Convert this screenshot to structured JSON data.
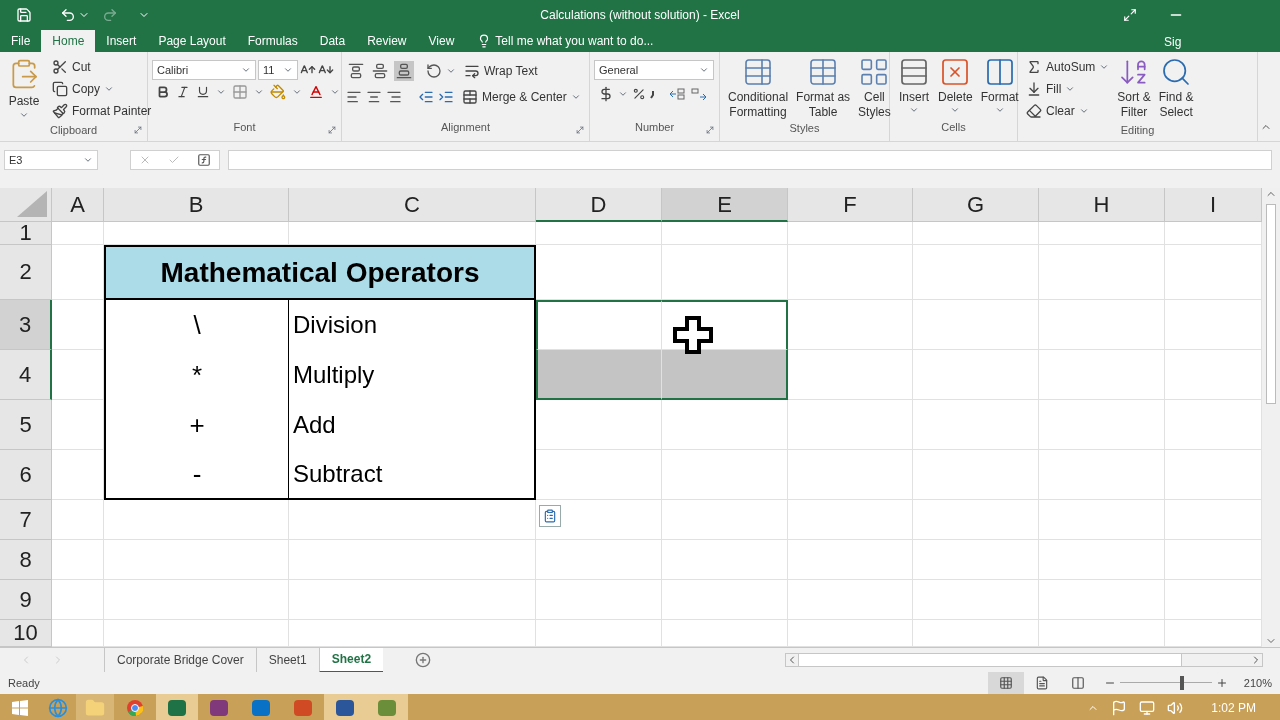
{
  "title_bar": {
    "title": "Calculations (without solution) - Excel"
  },
  "tabs": [
    {
      "label": "File",
      "selected": false
    },
    {
      "label": "Home",
      "selected": true
    },
    {
      "label": "Insert",
      "selected": false
    },
    {
      "label": "Page Layout",
      "selected": false
    },
    {
      "label": "Formulas",
      "selected": false
    },
    {
      "label": "Data",
      "selected": false
    },
    {
      "label": "Review",
      "selected": false
    },
    {
      "label": "View",
      "selected": false
    }
  ],
  "tell_me": "Tell me what you want to do...",
  "sign_in": "Sig",
  "ribbon": {
    "clipboard": {
      "label": "Clipboard",
      "paste": "Paste",
      "cut": "Cut",
      "copy": "Copy",
      "format_painter": "Format Painter"
    },
    "font": {
      "label": "Font",
      "font_name": "Calibri",
      "font_size": "11"
    },
    "alignment": {
      "label": "Alignment",
      "wrap_text": "Wrap Text",
      "merge_center": "Merge & Center",
      "vertical_align": [
        {
          "selected": false
        },
        {
          "selected": false
        },
        {
          "selected": true
        }
      ]
    },
    "number": {
      "label": "Number",
      "format": "General"
    },
    "styles": {
      "label": "Styles",
      "buttons": [
        "Conditional\nFormatting",
        "Format as\nTable",
        "Cell\nStyles"
      ]
    },
    "cells": {
      "label": "Cells",
      "buttons": [
        "Insert",
        "Delete",
        "Format"
      ]
    },
    "editing": {
      "label": "Editing",
      "autosum": "AutoSum",
      "fill": "Fill",
      "clear": "Clear",
      "sort_filter": "Sort &\nFilter",
      "find_select": "Find &\nSelect"
    }
  },
  "formula_bar": {
    "name_box": "E3"
  },
  "sheet": {
    "columns": [
      {
        "label": "A",
        "selected": false,
        "active": false
      },
      {
        "label": "B",
        "selected": false,
        "active": false
      },
      {
        "label": "C",
        "selected": false,
        "active": false
      },
      {
        "label": "D",
        "selected": true,
        "active": false
      },
      {
        "label": "E",
        "selected": true,
        "active": true
      },
      {
        "label": "F",
        "selected": false,
        "active": false
      },
      {
        "label": "G",
        "selected": false,
        "active": false
      },
      {
        "label": "H",
        "selected": false,
        "active": false
      },
      {
        "label": "I",
        "selected": false,
        "active": false
      }
    ],
    "rows": [
      {
        "label": "1",
        "selected": false,
        "active": false
      },
      {
        "label": "2",
        "selected": false,
        "active": false
      },
      {
        "label": "3",
        "selected": true,
        "active": true
      },
      {
        "label": "4",
        "selected": true,
        "active": false
      },
      {
        "label": "5",
        "selected": false,
        "active": false
      },
      {
        "label": "6",
        "selected": false,
        "active": false
      },
      {
        "label": "7",
        "selected": false,
        "active": false
      },
      {
        "label": "8",
        "selected": false,
        "active": false
      },
      {
        "label": "9",
        "selected": false,
        "active": false
      },
      {
        "label": "10",
        "selected": false,
        "active": false
      }
    ],
    "table": {
      "title": "Mathematical Operators",
      "items": [
        {
          "symbol": "\\",
          "name": "Division"
        },
        {
          "symbol": "*",
          "name": "Multiply"
        },
        {
          "symbol": "+",
          "name": "Add"
        },
        {
          "symbol": "-",
          "name": "Subtract"
        }
      ]
    }
  },
  "sheet_tabs": [
    {
      "label": "Corporate Bridge Cover",
      "selected": false
    },
    {
      "label": "Sheet1",
      "selected": false
    },
    {
      "label": "Sheet2",
      "selected": true
    }
  ],
  "status_bar": {
    "status": "Ready",
    "zoom": "210%",
    "zoom_slider": {
      "level": 0.68
    }
  },
  "taskbar": {
    "clock": "1:02 PM"
  }
}
